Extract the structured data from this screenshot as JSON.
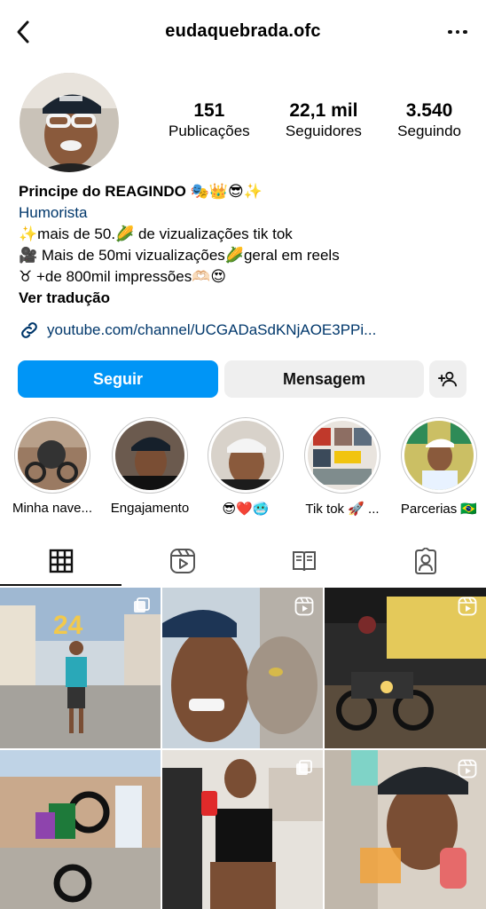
{
  "header": {
    "username": "eudaquebrada.ofc",
    "back_icon": "chevron-left-icon",
    "more_icon": "more-horizontal-icon"
  },
  "stats": {
    "posts_value": "151",
    "posts_label": "Publicações",
    "followers_value": "22,1 mil",
    "followers_label": "Seguidores",
    "following_value": "3.540",
    "following_label": "Seguindo"
  },
  "bio": {
    "name": "Principe do REAGINDO 🎭👑😎✨",
    "category": "Humorista",
    "line1": "✨mais de 50.🌽 de vizualizações tik tok",
    "line2": "🎥 Mais de 50mi vizualizações🌽geral em reels",
    "line3": "♉ +de 800mil impressões🫶🏻😍",
    "translate": "Ver tradução",
    "link": "youtube.com/channel/UCGADaSdKNjAOE3PPi..."
  },
  "actions": {
    "follow_label": "Seguir",
    "message_label": "Mensagem",
    "add_user_icon": "add-user-icon"
  },
  "highlights": [
    {
      "label": "Minha nave..."
    },
    {
      "label": "Engajamento"
    },
    {
      "label": "😎❤️🥶"
    },
    {
      "label": "Tik tok 🚀 ..."
    },
    {
      "label": "Parcerias 🇧🇷"
    }
  ],
  "tabs": [
    {
      "name": "grid",
      "icon": "grid-icon",
      "active": true
    },
    {
      "name": "reels",
      "icon": "reels-icon",
      "active": false
    },
    {
      "name": "guides",
      "icon": "book-icon",
      "active": false
    },
    {
      "name": "tagged",
      "icon": "tagged-user-icon",
      "active": false
    }
  ],
  "colors": {
    "accent": "#0095f6",
    "link": "#00376b",
    "button_secondary": "#efefef"
  }
}
